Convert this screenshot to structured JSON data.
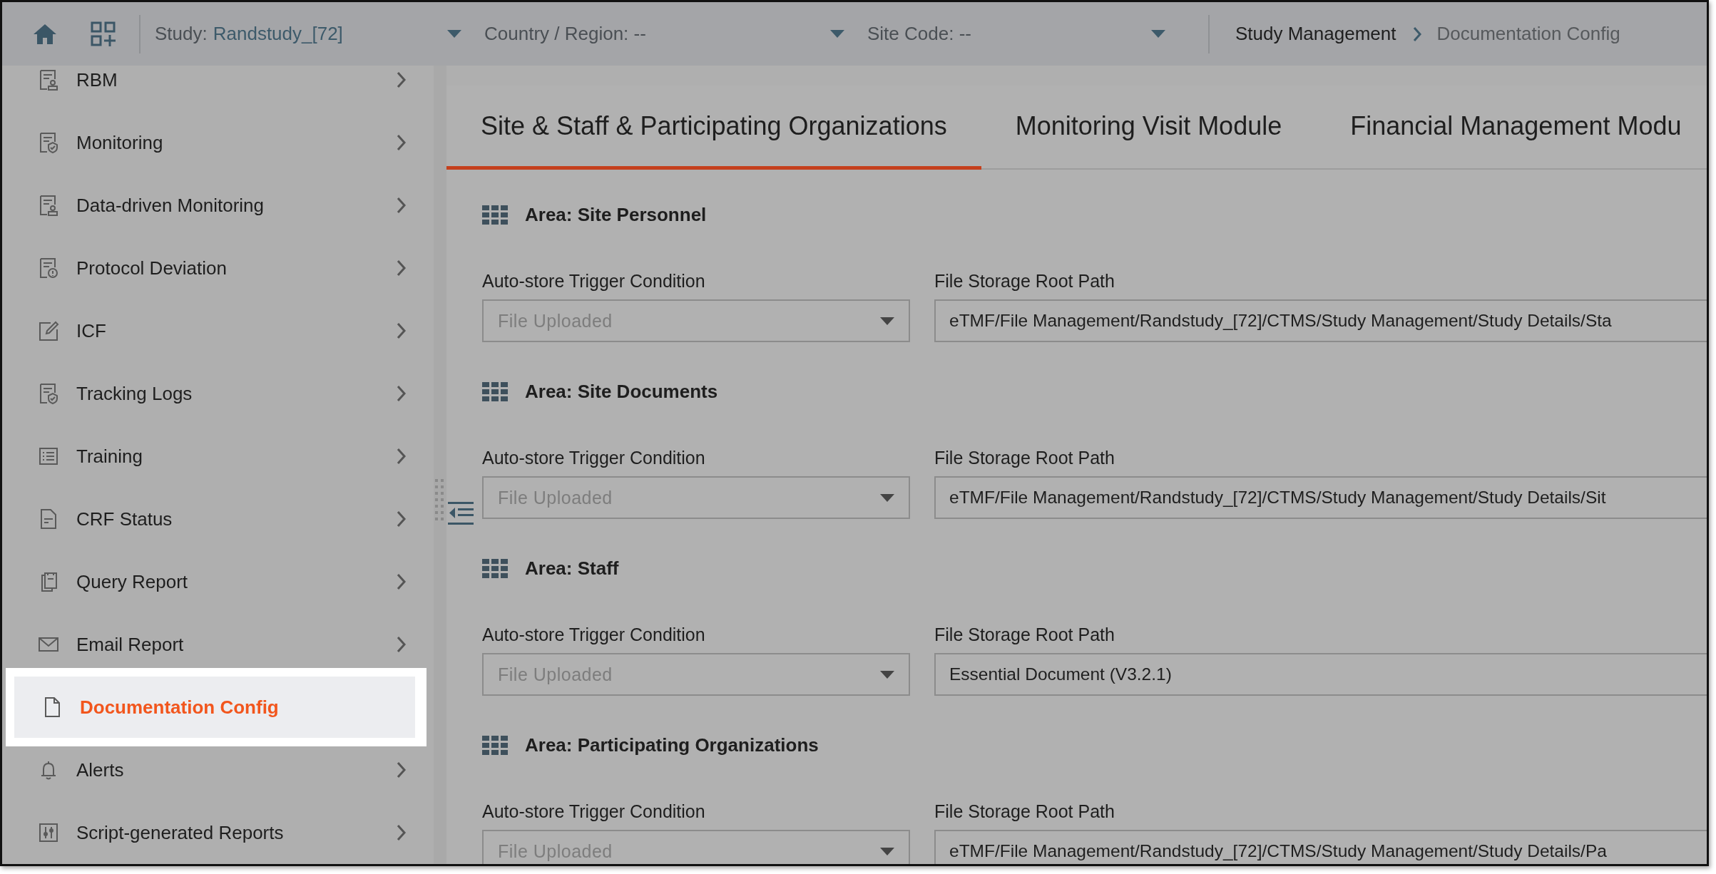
{
  "topbar": {
    "study": {
      "label": "Study:",
      "value": "Randstudy_[72]"
    },
    "country": {
      "label": "Country / Region: --"
    },
    "site": {
      "label": "Site Code: --"
    },
    "breadcrumbs": [
      {
        "label": "Study Management",
        "current": false
      },
      {
        "label": "Documentation Config",
        "current": true
      }
    ]
  },
  "sidebar": {
    "items": [
      {
        "label": "RBM",
        "selected": false
      },
      {
        "label": "Monitoring",
        "selected": false
      },
      {
        "label": "Data-driven Monitoring",
        "selected": false
      },
      {
        "label": "Protocol Deviation",
        "selected": false
      },
      {
        "label": "ICF",
        "selected": false
      },
      {
        "label": "Tracking Logs",
        "selected": false
      },
      {
        "label": "Training",
        "selected": false
      },
      {
        "label": "CRF Status",
        "selected": false
      },
      {
        "label": "Query Report",
        "selected": false
      },
      {
        "label": "Email Report",
        "selected": false
      },
      {
        "label": "Documentation Config",
        "selected": true
      },
      {
        "label": "Alerts",
        "selected": false
      },
      {
        "label": "Script-generated Reports",
        "selected": false
      }
    ]
  },
  "tabs": [
    {
      "label": "Site & Staff & Participating Organizations",
      "selected": true
    },
    {
      "label": "Monitoring Visit Module",
      "selected": false
    },
    {
      "label": "Financial Management Modu",
      "selected": false
    }
  ],
  "areas": [
    {
      "title": "Area: Site Personnel",
      "trigger": {
        "label": "Auto-store Trigger Condition",
        "placeholder": "File Uploaded"
      },
      "path": {
        "label": "File Storage Root Path",
        "value": "eTMF/File Management/Randstudy_[72]/CTMS/Study Management/Study Details/Sta"
      }
    },
    {
      "title": "Area: Site Documents",
      "trigger": {
        "label": "Auto-store Trigger Condition",
        "placeholder": "File Uploaded"
      },
      "path": {
        "label": "File Storage Root Path",
        "value": "eTMF/File Management/Randstudy_[72]/CTMS/Study Management/Study Details/Sit"
      }
    },
    {
      "title": "Area: Staff",
      "trigger": {
        "label": "Auto-store Trigger Condition",
        "placeholder": "File Uploaded"
      },
      "path": {
        "label": "File Storage Root Path",
        "value": "Essential Document (V3.2.1)"
      }
    },
    {
      "title": "Area: Participating Organizations",
      "trigger": {
        "label": "Auto-store Trigger Condition",
        "placeholder": "File Uploaded"
      },
      "path": {
        "label": "File Storage Root Path",
        "value": "eTMF/File Management/Randstudy_[72]/CTMS/Study Management/Study Details/Pa"
      }
    }
  ]
}
